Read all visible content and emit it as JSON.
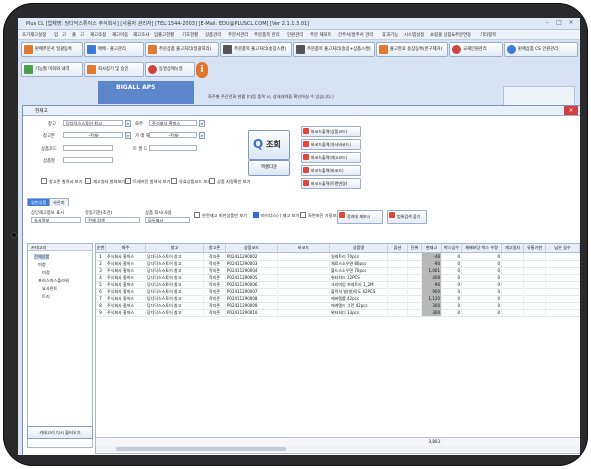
{
  "app": {
    "title": "Plus CL [업체명: 당다닥스튜어스 주식회사] [사용자 관리자] [TEL:1544-2003] [E-Mail: EDU@PLUSCL.COM] [Ver 2.1.1.3.01]"
  },
  "menu": [
    "조기재고설정",
    "입",
    "고",
    "출",
    "고",
    "재고조정",
    "재고이동",
    "재고조사",
    "입출고현황",
    "기초현황",
    "상품관리",
    "주문서관리",
    "주문품목 관리",
    "인원관리",
    "주문 재포트",
    "간주서/방주서 관리",
    "휴과기능",
    "시스템설정",
    "쇼핑몰 상품&주문연동",
    "기타항목"
  ],
  "toolbar": {
    "row1": [
      "판매주문서 일괄등록",
      "매배 · 출고관리",
      "주문상품 출고처리(일괄처리)",
      "주문품목 출고처리(송장스캔)",
      "주문품목 출고처리(송장+상품스캔)",
      "출고완료 송장등록(반구제거)",
      "교재인원관리",
      "판매상품 CS 인원관리"
    ],
    "row2": [
      "기능별 미화와 내역",
      "회사정기 및 승인",
      "동영상매뉴얼"
    ]
  },
  "ad": {
    "text": "BIGALL APS"
  },
  "info_text": "화주별 주간전화 현황 (다음 품목 시, 상세내역을 확인하실 수 있습니다.)",
  "window": {
    "title": "현재고"
  },
  "filters": {
    "warehouse_label": "창고",
    "warehouse_value": "당다닥스스토어 창고",
    "owner_label": "화주",
    "owner_value": "주식회사 홍까스",
    "location_label": "창고존",
    "location_value": "-전체-",
    "type_label": "가 래 처",
    "type_value": "-전체-",
    "product_code_label": "상품코드",
    "product_name_label": "상품명",
    "barcode_label": "트 랜 드"
  },
  "checks": [
    "창고존 발혀서 보기",
    "재고일자 발혀보기",
    "트래커진 발혀서 보기",
    "유효상품코드 보기",
    "상품 지정확인 보기"
  ],
  "buttons": {
    "search": "조회",
    "search_icon": "magnifier",
    "excel": "엑셀다운",
    "print1": "바코드출력(상품코드)",
    "print2": "바코드출력(자사바코드)",
    "print3": "바코드출력(재고코드)",
    "print4": "바코드출력(바코드)",
    "print5": "바코드출력(트렌변경)",
    "apply": "정과데 재보시",
    "detail": "범위검색 옵기"
  },
  "tabs": [
    "일반상품",
    "사은지"
  ],
  "options": {
    "sort_label": "상단재고정보 표시",
    "sort_value": "유사정보",
    "stock_label": "유동기준(조건)",
    "stock_value": "전체 검색",
    "item_label": "상품 묶시(사용",
    "item_value": "모두표시",
    "c1": "안전재고 미만상품만 보기",
    "c2": "마이너스(-) 재고 보기",
    "c3": "화면마진 가정보기"
  },
  "tree": {
    "header": "카테고리",
    "nodes": [
      "전체상품",
      "미청",
      "미정",
      "프러스마스플라워",
      "요사면트",
      "트리"
    ],
    "button": "카테고리 다시 불러오기"
  },
  "grid": {
    "headers": [
      "순번",
      "화주",
      "창고",
      "창고존",
      "상품코드",
      "바코드",
      "상품명",
      "옵션",
      "단위",
      "현재고",
      "박스입수",
      "재배포당 박스 수량",
      "재고일자",
      "유통기한",
      "남은 일수"
    ],
    "rows": [
      [
        "1",
        "주식회사 홍까스",
        "당다닥스스토어 창고",
        "작지존",
        "P02411290002",
        "",
        "일레트리 70pcs",
        "",
        "",
        "-48",
        "0",
        "0",
        "",
        "",
        ""
      ],
      [
        "2",
        "주식회사 홍까스",
        "당다닥스스토어 창고",
        "작지존",
        "P02411290003",
        "",
        "체료스소우면 80pcs",
        "",
        "",
        "-90",
        "0",
        "0",
        "",
        "",
        ""
      ],
      [
        "3",
        "주식회사 홍까스",
        "당다닥스스토어 창고",
        "작지존",
        "P02411290004",
        "",
        "블드스소우면 70pcs",
        "",
        "",
        "1,001",
        "0",
        "0",
        "",
        "",
        ""
      ],
      [
        "4",
        "주식회사 홍까스",
        "당다닥스스토어 창고",
        "작지존",
        "P02411290005",
        "",
        "위터처드 12PCS",
        "",
        "",
        "408",
        "0",
        "0",
        "",
        "",
        ""
      ],
      [
        "5",
        "주식회사 홍까스",
        "당다닥스스토어 창고",
        "작지존",
        "P02411290006",
        "",
        "크리미엄 프레트리 1_2M",
        "",
        "",
        "-96",
        "0",
        "0",
        "",
        "",
        ""
      ],
      [
        "6",
        "주식회사 홍까스",
        "당다닥스스토어 창고",
        "작지존",
        "P02411290007",
        "",
        "플락서 벌(벌)작도 42PCS",
        "",
        "",
        "900",
        "0",
        "0",
        "",
        "",
        ""
      ],
      [
        "7",
        "주식회사 홍까스",
        "당다닥스스토어 창고",
        "작지존",
        "P02411290008",
        "",
        "에버템를 42pcs",
        "",
        "",
        "1,120",
        "0",
        "0",
        "",
        "",
        ""
      ],
      [
        "8",
        "주식회사 홍까스",
        "당다닥스스토어 창고",
        "작지존",
        "P02411290009",
        "",
        "에게템드 그린 42pcs",
        "",
        "",
        "300",
        "0",
        "0",
        "",
        "",
        ""
      ],
      [
        "9",
        "주식회사 홍까스",
        "당다닥스스토어 창고",
        "작지존",
        "P02411290010",
        "",
        "위터처디 13pcs",
        "",
        "",
        "300",
        "0",
        "0",
        "",
        "",
        ""
      ]
    ],
    "total": "3,803"
  },
  "colors": {
    "accent": "#3e7bd8",
    "close": "#d23e3e",
    "bezel": "#2a2a2c"
  }
}
